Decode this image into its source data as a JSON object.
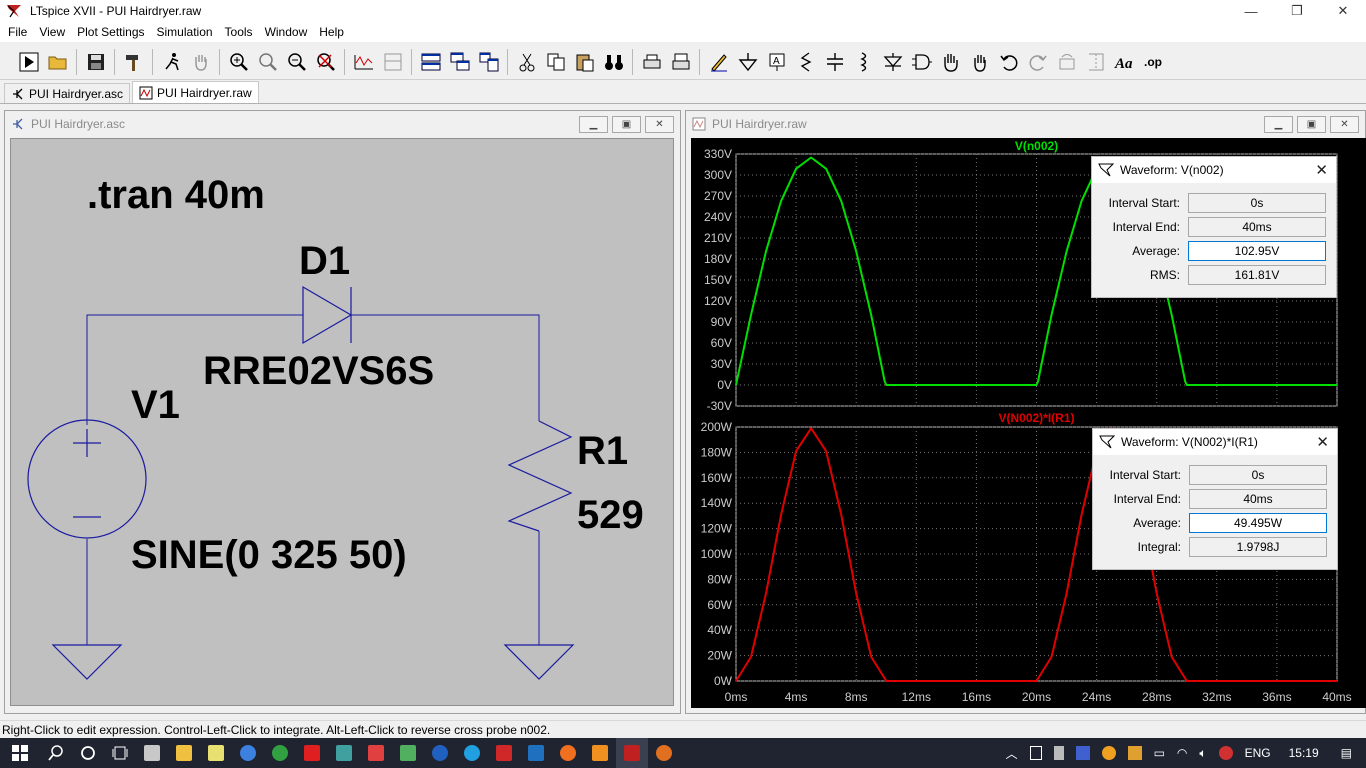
{
  "window": {
    "title": "LTspice XVII - PUI Hairdryer.raw"
  },
  "menu": [
    "File",
    "View",
    "Plot Settings",
    "Simulation",
    "Tools",
    "Window",
    "Help"
  ],
  "tabs": [
    {
      "label": "PUI Hairdryer.asc"
    },
    {
      "label": "PUI Hairdryer.raw"
    }
  ],
  "schematic": {
    "window_title": "PUI Hairdryer.asc",
    "directive": ".tran 40m",
    "diode_name": "D1",
    "diode_model": "RRE02VS6S",
    "source_name": "V1",
    "source_value": "SINE(0 325 50)",
    "resistor_name": "R1",
    "resistor_value": "529"
  },
  "plot_window": {
    "title": "PUI Hairdryer.raw"
  },
  "chart_data": [
    {
      "type": "line",
      "title": "V(n002)",
      "series_color": "#00e000",
      "ylim": [
        -30,
        330
      ],
      "xlim": [
        0,
        40
      ],
      "yticks": [
        "330V",
        "300V",
        "270V",
        "240V",
        "210V",
        "180V",
        "150V",
        "120V",
        "90V",
        "60V",
        "30V",
        "0V",
        "-30V"
      ],
      "xticks": [],
      "series": [
        {
          "x": [
            0,
            1,
            2,
            3,
            4,
            5,
            6,
            7,
            8,
            9,
            9.9,
            10,
            20,
            20.1,
            21,
            22,
            23,
            24,
            25,
            26,
            27,
            28,
            29,
            29.9,
            30,
            40
          ],
          "values": [
            0,
            100,
            191,
            263,
            309,
            325,
            309,
            263,
            191,
            100,
            5,
            0,
            0,
            5,
            100,
            191,
            263,
            309,
            325,
            309,
            263,
            191,
            100,
            5,
            0,
            0
          ]
        }
      ]
    },
    {
      "type": "line",
      "title": "V(N002)*I(R1)",
      "series_color": "#e00000",
      "ylim": [
        0,
        200
      ],
      "xlim": [
        0,
        40
      ],
      "yticks": [
        "200W",
        "180W",
        "160W",
        "140W",
        "120W",
        "100W",
        "80W",
        "60W",
        "40W",
        "20W",
        "0W"
      ],
      "xticks": [
        "0ms",
        "4ms",
        "8ms",
        "12ms",
        "16ms",
        "20ms",
        "24ms",
        "28ms",
        "32ms",
        "36ms",
        "40ms"
      ],
      "series": [
        {
          "x": [
            0,
            1,
            2,
            3,
            4,
            5,
            6,
            7,
            8,
            9,
            10,
            20,
            21,
            22,
            23,
            24,
            25,
            26,
            27,
            28,
            29,
            30,
            40
          ],
          "values": [
            0,
            19,
            69,
            131,
            181,
            199,
            181,
            131,
            69,
            19,
            0,
            0,
            19,
            69,
            131,
            181,
            199,
            181,
            131,
            69,
            19,
            0,
            0
          ]
        }
      ]
    }
  ],
  "waveform_dialogs": [
    {
      "title": "Waveform: V(n002)",
      "rows": [
        {
          "label": "Interval Start:",
          "value": "0s"
        },
        {
          "label": "Interval End:",
          "value": "40ms"
        },
        {
          "label": "Average:",
          "value": "102.95V"
        },
        {
          "label": "RMS:",
          "value": "161.81V"
        }
      ]
    },
    {
      "title": "Waveform: V(N002)*I(R1)",
      "rows": [
        {
          "label": "Interval Start:",
          "value": "0s"
        },
        {
          "label": "Interval End:",
          "value": "40ms"
        },
        {
          "label": "Average:",
          "value": "49.495W"
        },
        {
          "label": "Integral:",
          "value": "1.9798J"
        }
      ]
    }
  ],
  "status": {
    "text": "Right-Click to edit expression. Control-Left-Click to integrate. Alt-Left-Click to reverse cross probe n002."
  },
  "tray": {
    "lang": "ENG",
    "time": "15:19"
  }
}
